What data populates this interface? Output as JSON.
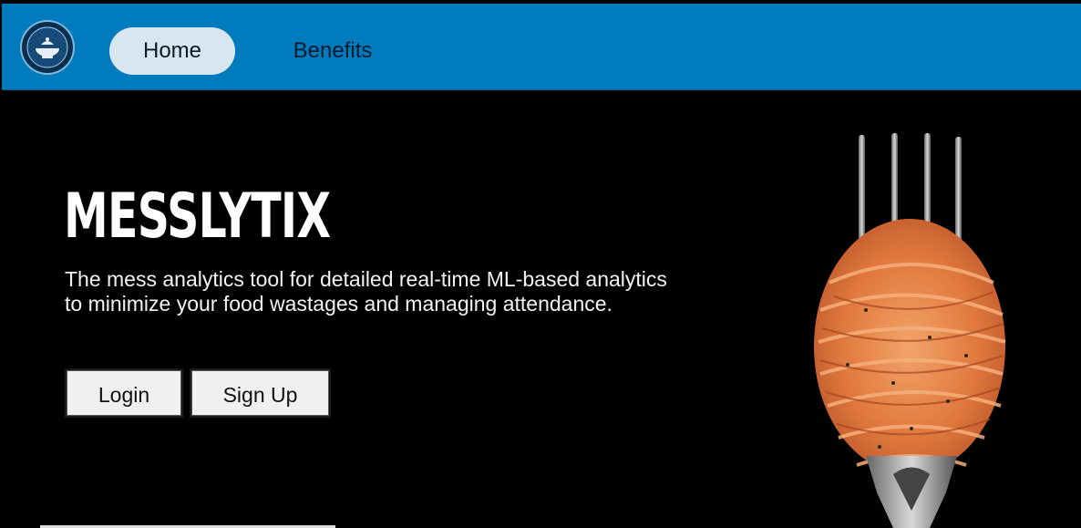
{
  "navbar": {
    "logo_icon": "messlytix-logo-icon",
    "items": [
      {
        "label": "Home",
        "active": true
      },
      {
        "label": "Benefits",
        "active": false
      }
    ],
    "colors": {
      "background": "#007bbd",
      "active_pill": "#d8e6ef"
    }
  },
  "hero": {
    "title": "MESSLYTIX",
    "description": "The mess analytics tool for detailed real-time ML-based analytics to minimize your food wastages and managing attendance.",
    "buttons": {
      "login_label": "Login",
      "signup_label": "Sign Up"
    },
    "image_icon": "spaghetti-fork-image"
  }
}
